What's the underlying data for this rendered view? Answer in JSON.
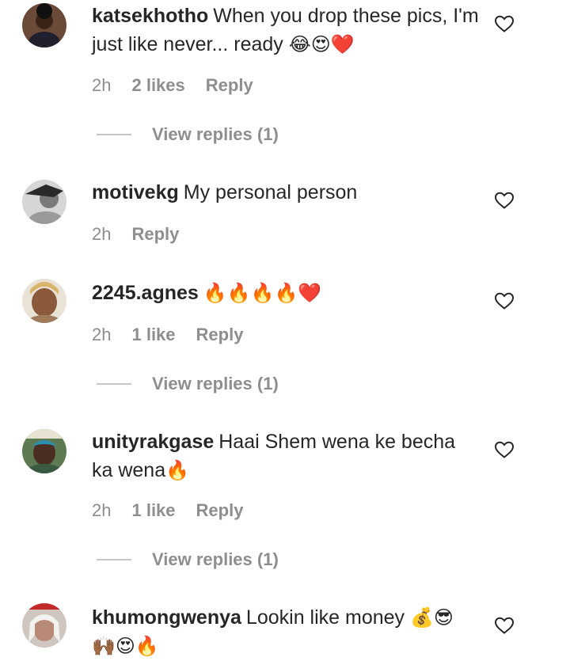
{
  "comments": [
    {
      "username": "katsekhotho",
      "text": "When you drop these pics, I'm just like never... ready",
      "emoji": "😂😍❤️",
      "time": "2h",
      "likes": "2 likes",
      "reply": "Reply",
      "view_replies": "View replies (1)"
    },
    {
      "username": "motivekg",
      "text": "My personal person",
      "emoji": "",
      "time": "2h",
      "likes": "",
      "reply": "Reply",
      "view_replies": ""
    },
    {
      "username": "2245.agnes",
      "text": "",
      "emoji": "🔥🔥🔥🔥❤️",
      "time": "2h",
      "likes": "1 like",
      "reply": "Reply",
      "view_replies": "View replies (1)"
    },
    {
      "username": "unityrakgase",
      "text": "Haai Shem wena ke becha ka wena",
      "emoji": "🔥",
      "time": "2h",
      "likes": "1 like",
      "reply": "Reply",
      "view_replies": "View replies (1)"
    },
    {
      "username": "khumongwenya",
      "text": "Lookin like money",
      "emoji": "💰😎 🙌🏾😍🔥",
      "time": "",
      "likes": "",
      "reply": "",
      "view_replies": ""
    }
  ],
  "colors": {
    "text": "#262626",
    "muted": "#8e8e8e",
    "divider": "#c7c7c7",
    "background": "#ffffff"
  },
  "icons": {
    "like": "heart-outline-icon"
  }
}
